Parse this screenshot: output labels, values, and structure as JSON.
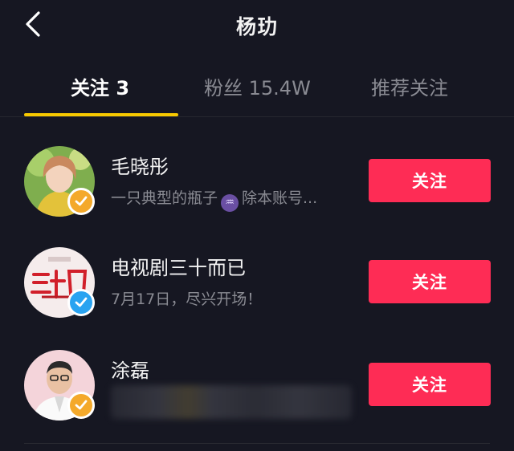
{
  "header": {
    "title": "杨玏",
    "back_icon": "chevron-left-icon"
  },
  "tabs": [
    {
      "label": "关注 3",
      "active": true
    },
    {
      "label": "粉丝 15.4W",
      "active": false
    },
    {
      "label": "推荐关注",
      "active": false
    }
  ],
  "accent": {
    "tab_underline": "#f7c900",
    "follow_button": "#fe2c55",
    "verify_gold": "#f4a92b",
    "verify_blue": "#29a3f1"
  },
  "users": [
    {
      "name": "毛晓彤",
      "desc_before": "一只典型的瓶子",
      "desc_after": "除本账号...",
      "desc_icon": "aquarius-icon",
      "badge": "gold",
      "follow_label": "关注"
    },
    {
      "name": "电视剧三十而已",
      "desc": "7月17日，尽兴开场！",
      "badge": "blue",
      "follow_label": "关注"
    },
    {
      "name": "涂磊",
      "desc": "",
      "badge": "gold",
      "follow_label": "关注"
    }
  ]
}
